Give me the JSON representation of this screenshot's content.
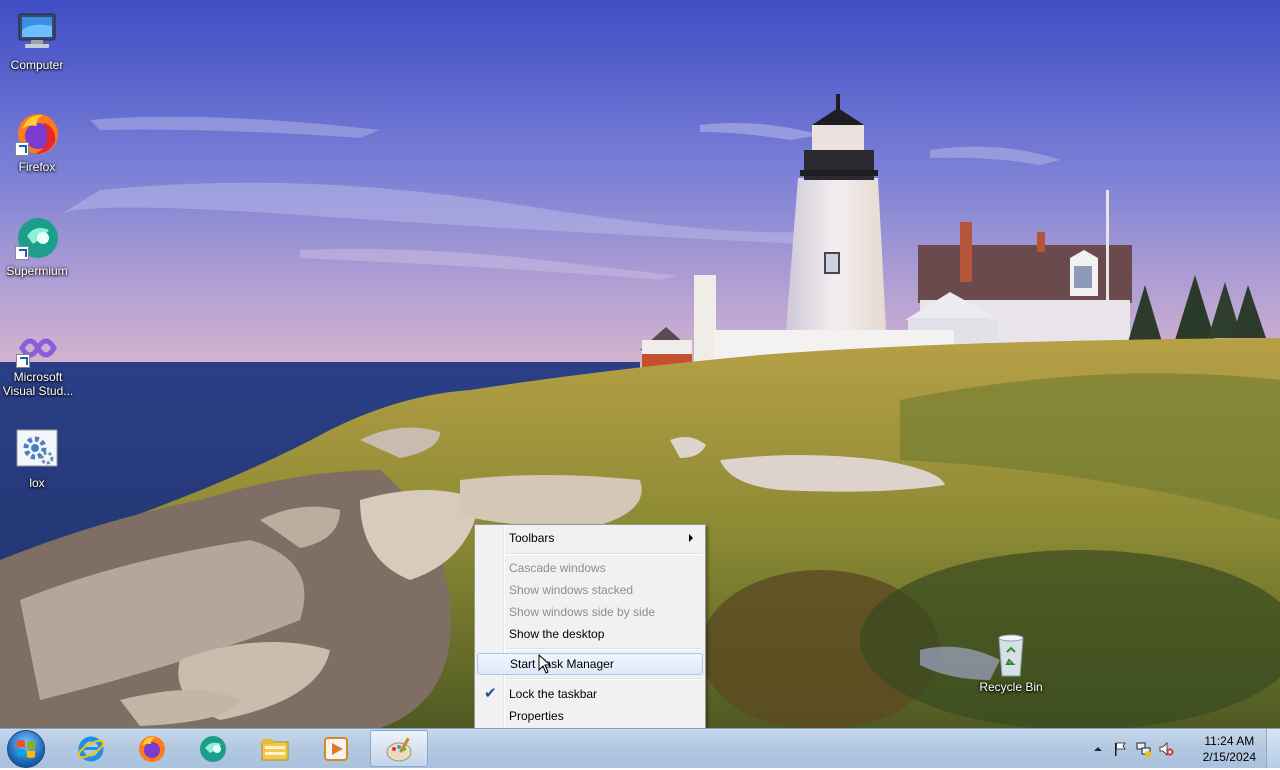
{
  "desktop": {
    "icons": [
      {
        "label": "Computer",
        "icon": "computer-icon"
      },
      {
        "label": "Firefox",
        "icon": "firefox-icon"
      },
      {
        "label": "Supermium",
        "icon": "supermium-icon"
      },
      {
        "label": "Microsoft Visual Stud...",
        "icon": "visual-studio-icon"
      },
      {
        "label": "lox",
        "icon": "settings-app-icon"
      },
      {
        "label": "Recycle Bin",
        "icon": "recycle-bin-icon"
      }
    ]
  },
  "context_menu": {
    "items": [
      {
        "label": "Toolbars",
        "enabled": true,
        "submenu": true
      },
      {
        "label": "Cascade windows",
        "enabled": false
      },
      {
        "label": "Show windows stacked",
        "enabled": false
      },
      {
        "label": "Show windows side by side",
        "enabled": false
      },
      {
        "label": "Show the desktop",
        "enabled": true
      },
      {
        "label": "Start Task Manager",
        "enabled": true,
        "highlighted": true
      },
      {
        "label": "Lock the taskbar",
        "enabled": true,
        "checked": true
      },
      {
        "label": "Properties",
        "enabled": true
      }
    ]
  },
  "taskbar": {
    "pinned": [
      {
        "icon": "internet-explorer-icon"
      },
      {
        "icon": "firefox-icon"
      },
      {
        "icon": "supermium-icon"
      },
      {
        "icon": "file-explorer-icon"
      },
      {
        "icon": "media-player-icon"
      },
      {
        "icon": "paint-icon",
        "active": true
      }
    ],
    "clock": {
      "time": "11:24 AM",
      "date": "2/15/2024"
    }
  },
  "colors": {
    "sky_top": "#4756c6",
    "sky_bottom": "#b9a6d3",
    "sea": "#28407e",
    "grass": "#8a8b36",
    "menu_bg": "#f1f1f1",
    "menu_highlight": "#dde9fa",
    "taskbar": "#b3c9e2"
  }
}
